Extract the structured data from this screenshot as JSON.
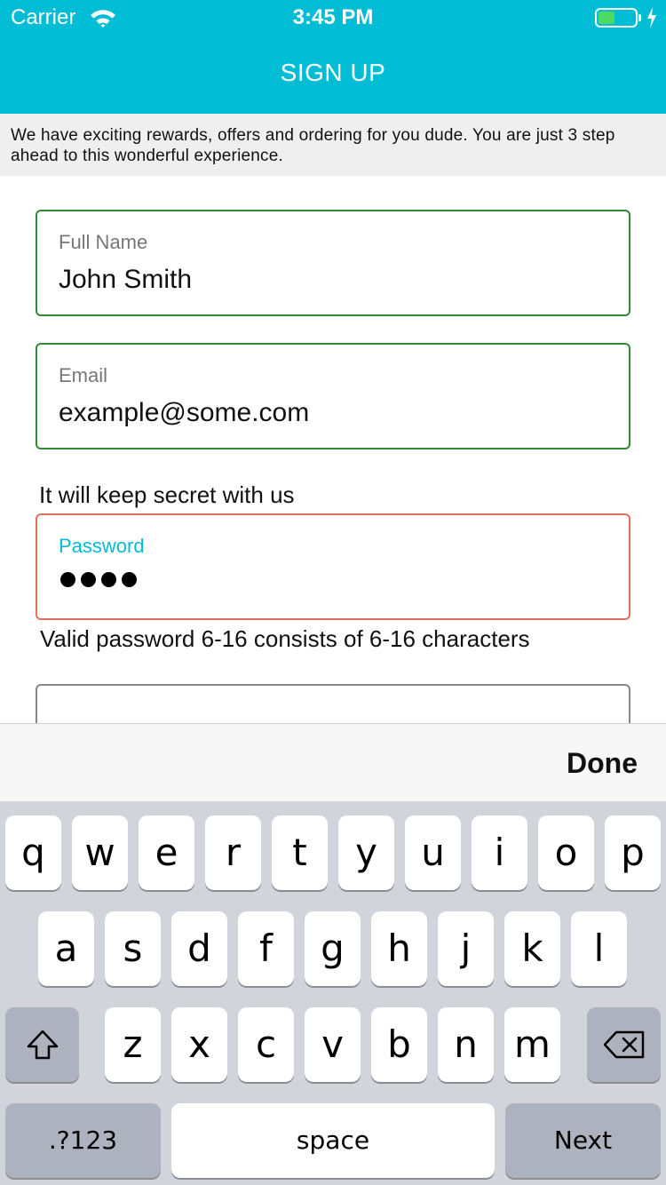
{
  "status_bar": {
    "carrier": "Carrier",
    "time": "3:45 PM",
    "battery_level": 0.45
  },
  "header": {
    "title": "SIGN UP",
    "background_color": "#00BCD4"
  },
  "intro": {
    "text": "We have exciting rewards, offers and ordering for you dude. You are just 3 step ahead to this wonderful experience."
  },
  "form": {
    "full_name": {
      "label": "Full Name",
      "value": "John Smith"
    },
    "email": {
      "label": "Email",
      "value": "example@some.com"
    },
    "secret_note": "It will keep secret with us",
    "password": {
      "label": "Password",
      "masked_length": 4
    },
    "password_hint": "Valid password 6-16 consists of 6-16 characters"
  },
  "accessory": {
    "done_label": "Done"
  },
  "keyboard": {
    "row1": [
      "q",
      "w",
      "e",
      "r",
      "t",
      "y",
      "u",
      "i",
      "o",
      "p"
    ],
    "row2": [
      "a",
      "s",
      "d",
      "f",
      "g",
      "h",
      "j",
      "k",
      "l"
    ],
    "row3": [
      "z",
      "x",
      "c",
      "v",
      "b",
      "n",
      "m"
    ],
    "shift_icon": "shift-icon",
    "delete_icon": "delete-icon",
    "numbers_label": ".?123",
    "space_label": "space",
    "next_label": "Next"
  },
  "colors": {
    "accent": "#00BCD4",
    "valid_border": "#2E8B2E",
    "error_border": "#E07060"
  }
}
